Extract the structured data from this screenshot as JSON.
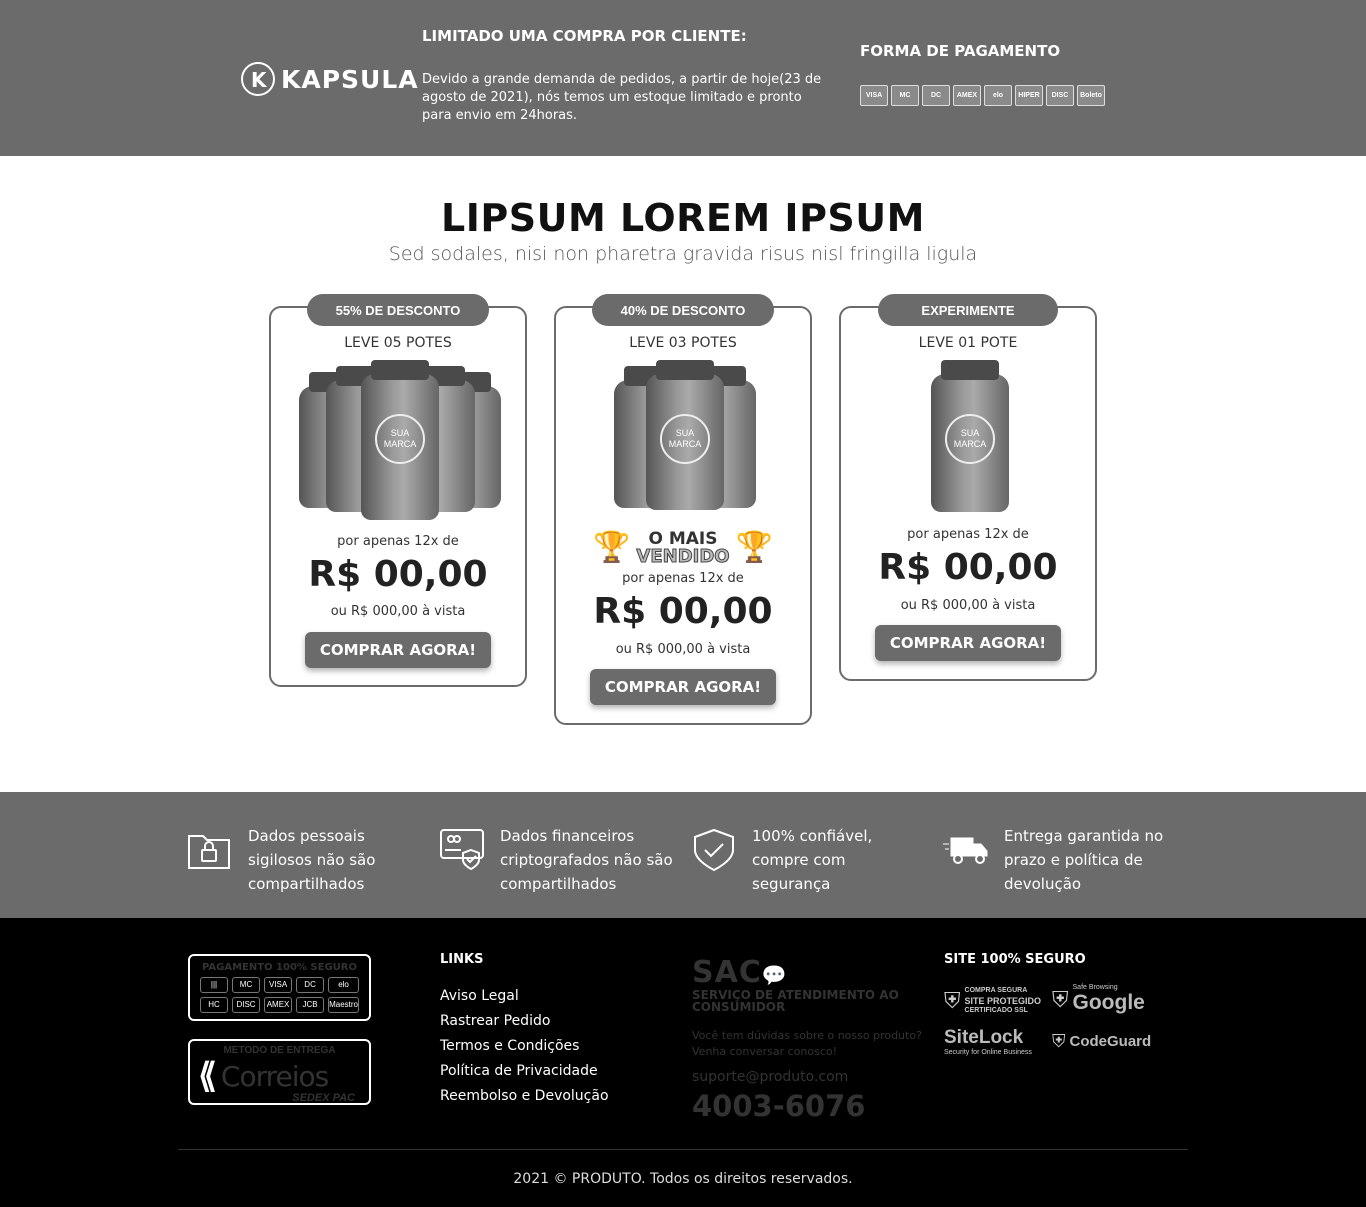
{
  "topbar": {
    "logo_text": "KAPSULA",
    "logo_letter": "K",
    "notice_title": "LIMITADO UMA COMPRA POR CLIENTE:",
    "notice_text": "Devido a grande demanda de pedidos, a partir de hoje(23 de agosto de 2021), nós temos um estoque limitado e pronto para envio em 24horas.",
    "payment_title": "FORMA DE PAGAMENTO",
    "payment_icons": [
      "VISA",
      "MC",
      "DC",
      "AMEX",
      "elo",
      "HIPER",
      "DISC",
      "Boleto"
    ]
  },
  "hero": {
    "title": "LIPSUM LOREM IPSUM",
    "subtitle": "Sed sodales, nisi non pharetra gravida risus nisl fringilla ligula"
  },
  "cards": [
    {
      "badge": "55% DE DESCONTO",
      "heading": "LEVE 05 POTES",
      "price_prefix": "por apenas 12x de",
      "price": "R$ 00,00",
      "price_alt": "ou R$ 000,00 à vista",
      "button": "COMPRAR AGORA!"
    },
    {
      "badge": "40% DE DESCONTO",
      "heading": "LEVE 03 POTES",
      "best_a": "O MAIS",
      "best_b": "VENDIDO",
      "price_prefix": "por apenas 12x de",
      "price": "R$ 00,00",
      "price_alt": "ou R$ 000,00 à vista",
      "button": "COMPRAR AGORA!"
    },
    {
      "badge": "EXPERIMENTE",
      "heading": "LEVE 01 POTE",
      "price_prefix": "por apenas 12x de",
      "price": "R$ 00,00",
      "price_alt": "ou R$ 000,00 à vista",
      "button": "COMPRAR AGORA!"
    }
  ],
  "bottle_label": "SUA MARCA",
  "features": [
    {
      "icon": "folder-lock-icon",
      "text": "Dados pessoais sigilosos não são compartilhados"
    },
    {
      "icon": "card-shield-icon",
      "text": "Dados financeiros criptografados não são compartilhados"
    },
    {
      "icon": "shield-check-icon",
      "text": "100% confiável, compre com segurança"
    },
    {
      "icon": "truck-icon",
      "text": "Entrega garantida no prazo e política de devolução"
    }
  ],
  "footer": {
    "seal_payment_title": "PAGAMENTO 100% SEGURO",
    "seal_payment_items": [
      "|||",
      "MC",
      "VISA",
      "DC",
      "elo",
      "HC",
      "DISC",
      "AMEX",
      "JCB",
      "Maestro"
    ],
    "seal_delivery_title": "METODO DE ENTREGA",
    "seal_delivery_brand": "Correios",
    "seal_delivery_bottom": "SEDEX   PAC",
    "links_title": "LINKS",
    "links": [
      "Aviso Legal",
      "Rastrear Pedido",
      "Termos e Condições",
      "Política de Privacidade",
      "Reembolso e Devolução"
    ],
    "sac_logo": "SAC",
    "sac_title": "SERVIÇO DE ATENDIMENTO AO CONSUMIDOR",
    "sac_text": "Você tem dúvidas sobre o nosso produto? Venha conversar conosco!",
    "sac_email": "suporte@produto.com",
    "sac_phone": "4003-6076",
    "secure_title": "SITE 100% SEGURO",
    "secure_badges": {
      "ssl_a": "COMPRA SEGURA",
      "ssl_b": "SITE PROTEGIDO",
      "ssl_c": "CERTIFICADO SSL",
      "google_small": "Safe Browsing",
      "google": "Google",
      "sitelock": "SiteLock",
      "sitelock_sub": "Security for Online Business",
      "codeguard": "CodeGuard"
    },
    "copyright": "2021 © PRODUTO. Todos os direitos reservados."
  }
}
